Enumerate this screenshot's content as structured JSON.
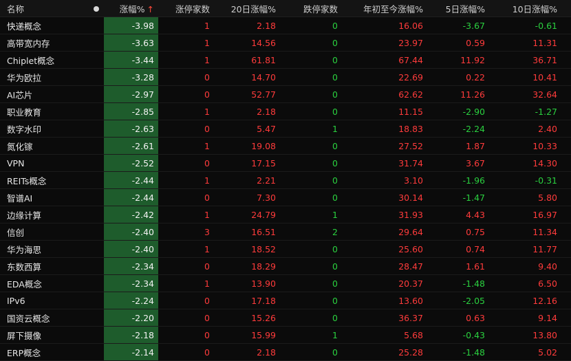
{
  "headers": {
    "name": "名称",
    "pct": "涨幅%",
    "sort_arrow": "↑",
    "limit_up": "涨停家数",
    "change_20d": "20日涨幅%",
    "limit_down": "跌停家数",
    "ytd": "年初至今涨幅%",
    "change_5d": "5日涨幅%",
    "change_10d": "10日涨幅%"
  },
  "colors": {
    "up": "#ff3b3b",
    "down": "#2ad03f",
    "pct_column_bg": "#1e5c2c"
  },
  "rows": [
    {
      "name": "快递概念",
      "pct": "-3.98",
      "limit_up": "1",
      "change_20d": "2.18",
      "limit_down": "0",
      "ytd": "16.06",
      "change_5d": "-3.67",
      "change_10d": "-0.61"
    },
    {
      "name": "高带宽内存",
      "pct": "-3.63",
      "limit_up": "1",
      "change_20d": "14.56",
      "limit_down": "0",
      "ytd": "23.97",
      "change_5d": "0.59",
      "change_10d": "11.31"
    },
    {
      "name": "Chiplet概念",
      "pct": "-3.44",
      "limit_up": "1",
      "change_20d": "61.81",
      "limit_down": "0",
      "ytd": "67.44",
      "change_5d": "11.92",
      "change_10d": "36.71"
    },
    {
      "name": "华为欧拉",
      "pct": "-3.28",
      "limit_up": "0",
      "change_20d": "14.70",
      "limit_down": "0",
      "ytd": "22.69",
      "change_5d": "0.22",
      "change_10d": "10.41"
    },
    {
      "name": "AI芯片",
      "pct": "-2.97",
      "limit_up": "0",
      "change_20d": "52.77",
      "limit_down": "0",
      "ytd": "62.62",
      "change_5d": "11.26",
      "change_10d": "32.64"
    },
    {
      "name": "职业教育",
      "pct": "-2.85",
      "limit_up": "1",
      "change_20d": "2.18",
      "limit_down": "0",
      "ytd": "11.15",
      "change_5d": "-2.90",
      "change_10d": "-1.27"
    },
    {
      "name": "数字水印",
      "pct": "-2.63",
      "limit_up": "0",
      "change_20d": "5.47",
      "limit_down": "1",
      "ytd": "18.83",
      "change_5d": "-2.24",
      "change_10d": "2.40"
    },
    {
      "name": "氮化镓",
      "pct": "-2.61",
      "limit_up": "1",
      "change_20d": "19.08",
      "limit_down": "0",
      "ytd": "27.52",
      "change_5d": "1.87",
      "change_10d": "10.33"
    },
    {
      "name": "VPN",
      "pct": "-2.52",
      "limit_up": "0",
      "change_20d": "17.15",
      "limit_down": "0",
      "ytd": "31.74",
      "change_5d": "3.67",
      "change_10d": "14.30"
    },
    {
      "name": "REITs概念",
      "pct": "-2.44",
      "limit_up": "1",
      "change_20d": "2.21",
      "limit_down": "0",
      "ytd": "3.10",
      "change_5d": "-1.96",
      "change_10d": "-0.31"
    },
    {
      "name": "智谱AI",
      "pct": "-2.44",
      "limit_up": "0",
      "change_20d": "7.30",
      "limit_down": "0",
      "ytd": "30.14",
      "change_5d": "-1.47",
      "change_10d": "5.80"
    },
    {
      "name": "边缘计算",
      "pct": "-2.42",
      "limit_up": "1",
      "change_20d": "24.79",
      "limit_down": "1",
      "ytd": "31.93",
      "change_5d": "4.43",
      "change_10d": "16.97"
    },
    {
      "name": "信创",
      "pct": "-2.40",
      "limit_up": "3",
      "change_20d": "16.51",
      "limit_down": "2",
      "ytd": "29.64",
      "change_5d": "0.75",
      "change_10d": "11.34"
    },
    {
      "name": "华为海思",
      "pct": "-2.40",
      "limit_up": "1",
      "change_20d": "18.52",
      "limit_down": "0",
      "ytd": "25.60",
      "change_5d": "0.74",
      "change_10d": "11.77"
    },
    {
      "name": "东数西算",
      "pct": "-2.34",
      "limit_up": "0",
      "change_20d": "18.29",
      "limit_down": "0",
      "ytd": "28.47",
      "change_5d": "1.61",
      "change_10d": "9.40"
    },
    {
      "name": "EDA概念",
      "pct": "-2.34",
      "limit_up": "1",
      "change_20d": "13.90",
      "limit_down": "0",
      "ytd": "20.37",
      "change_5d": "-1.48",
      "change_10d": "6.50"
    },
    {
      "name": "IPv6",
      "pct": "-2.24",
      "limit_up": "0",
      "change_20d": "17.18",
      "limit_down": "0",
      "ytd": "13.60",
      "change_5d": "-2.05",
      "change_10d": "12.16"
    },
    {
      "name": "国资云概念",
      "pct": "-2.20",
      "limit_up": "0",
      "change_20d": "15.26",
      "limit_down": "0",
      "ytd": "36.37",
      "change_5d": "0.63",
      "change_10d": "9.14"
    },
    {
      "name": "屏下摄像",
      "pct": "-2.18",
      "limit_up": "0",
      "change_20d": "15.99",
      "limit_down": "1",
      "ytd": "5.68",
      "change_5d": "-0.43",
      "change_10d": "13.80"
    },
    {
      "name": "ERP概念",
      "pct": "-2.14",
      "limit_up": "0",
      "change_20d": "2.18",
      "limit_down": "0",
      "ytd": "25.28",
      "change_5d": "-1.48",
      "change_10d": "5.02"
    }
  ]
}
